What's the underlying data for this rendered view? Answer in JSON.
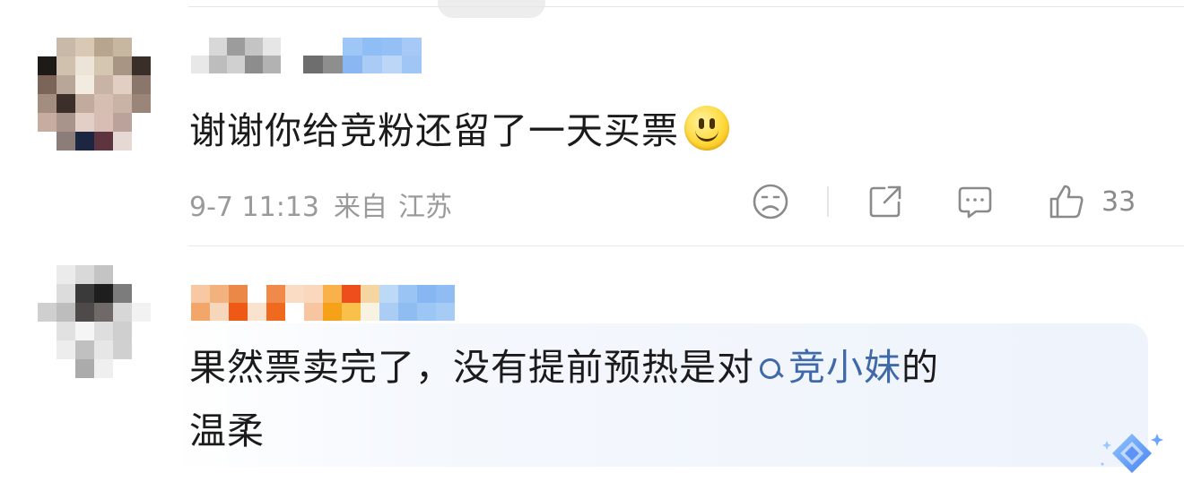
{
  "comments": [
    {
      "text": "谢谢你给竞粉还留了一天买票",
      "emoji": "smile-emoji",
      "date": "9-7 11:13",
      "location_prefix": "来自",
      "location": "江苏",
      "actions": {
        "dislike_icon": "sad-face-icon",
        "share_icon": "share-icon",
        "comment_icon": "comment-icon",
        "like_icon": "thumbs-up-icon",
        "like_count": "33"
      }
    },
    {
      "text_before": "果然票卖完了，没有提前预热是对",
      "mention": "竞小妹",
      "text_after_line1": "的",
      "text_line2": "温柔",
      "mention_icon": "search-icon",
      "badge_icon": "ai-diamond-icon"
    }
  ],
  "colors": {
    "text": "#1b1b1b",
    "meta": "#9a9a9a",
    "link": "#3f69a8",
    "icon": "#8a8a8a"
  }
}
